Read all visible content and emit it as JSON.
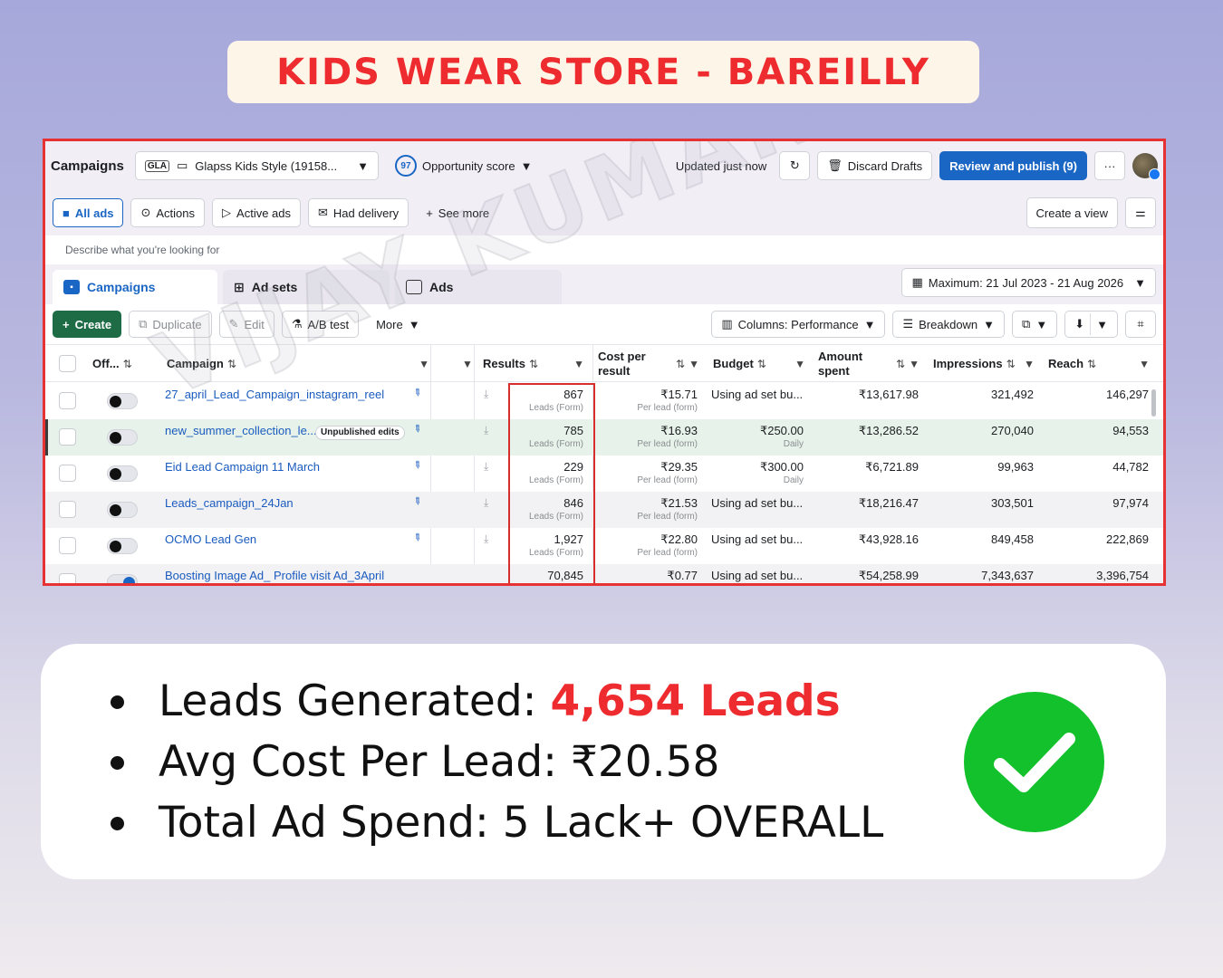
{
  "banner": {
    "title": "KIDS WEAR STORE - BAREILLY"
  },
  "topbar": {
    "title": "Campaigns",
    "account_badge": "GLA",
    "account": "Glapss Kids Style (19158...",
    "score_value": "97",
    "score_label": "Opportunity score",
    "updated": "Updated just now",
    "discard": "Discard Drafts",
    "review": "Review and publish (9)",
    "more": "···"
  },
  "filters": {
    "all_ads": "All ads",
    "actions": "Actions",
    "active_ads": "Active ads",
    "had_delivery": "Had delivery",
    "see_more": "See more",
    "create_view": "Create a view"
  },
  "search": {
    "placeholder": "Describe what you're looking for"
  },
  "tabs": {
    "campaigns": "Campaigns",
    "adsets": "Ad sets",
    "ads": "Ads",
    "date_range": "Maximum: 21 Jul 2023 - 21 Aug 2026"
  },
  "toolbar": {
    "create": "Create",
    "duplicate": "Duplicate",
    "edit": "Edit",
    "abtest": "A/B test",
    "more": "More",
    "columns": "Columns: Performance",
    "breakdown": "Breakdown"
  },
  "columns": {
    "off": "Off...",
    "campaign": "Campaign",
    "results": "Results",
    "cost_per_result": "Cost per result",
    "budget": "Budget",
    "amount_spent": "Amount spent",
    "impressions": "Impressions",
    "reach": "Reach"
  },
  "rows": [
    {
      "name": "27_april_Lead_Campaign_instagram_reel",
      "results": "867",
      "results_sub": "Leads (Form)",
      "cpr": "₹15.71",
      "cpr_sub": "Per lead (form)",
      "budget": "Using ad set bu...",
      "budget_sub": "",
      "spent": "₹13,617.98",
      "impressions": "321,492",
      "reach": "146,297",
      "badge": ""
    },
    {
      "name": "new_summer_collection_le...",
      "results": "785",
      "results_sub": "Leads (Form)",
      "cpr": "₹16.93",
      "cpr_sub": "Per lead (form)",
      "budget": "₹250.00",
      "budget_sub": "Daily",
      "spent": "₹13,286.52",
      "impressions": "270,040",
      "reach": "94,553",
      "badge": "Unpublished edits"
    },
    {
      "name": "Eid Lead Campaign 11 March",
      "results": "229",
      "results_sub": "Leads (Form)",
      "cpr": "₹29.35",
      "cpr_sub": "Per lead (form)",
      "budget": "₹300.00",
      "budget_sub": "Daily",
      "spent": "₹6,721.89",
      "impressions": "99,963",
      "reach": "44,782",
      "badge": ""
    },
    {
      "name": "Leads_campaign_24Jan",
      "results": "846",
      "results_sub": "Leads (Form)",
      "cpr": "₹21.53",
      "cpr_sub": "Per lead (form)",
      "budget": "Using ad set bu...",
      "budget_sub": "",
      "spent": "₹18,216.47",
      "impressions": "303,501",
      "reach": "97,974",
      "badge": ""
    },
    {
      "name": "OCMO Lead Gen",
      "results": "1,927",
      "results_sub": "Leads (Form)",
      "cpr": "₹22.80",
      "cpr_sub": "Per lead (form)",
      "budget": "Using ad set bu...",
      "budget_sub": "",
      "spent": "₹43,928.16",
      "impressions": "849,458",
      "reach": "222,869",
      "badge": ""
    },
    {
      "name": "Boosting Image Ad_ Profile visit Ad_3April",
      "results": "70,845",
      "results_sub": "",
      "cpr": "₹0.77",
      "cpr_sub": "",
      "budget": "Using ad set bu...",
      "budget_sub": "",
      "spent": "₹54,258.99",
      "impressions": "7,343,637",
      "reach": "3,396,754",
      "badge": ""
    }
  ],
  "watermark": "VIJAY KUMAR",
  "summary": {
    "leads_label": "Leads Generated: ",
    "leads_value": "4,654 Leads",
    "cpl": "Avg Cost Per Lead: ₹20.58",
    "spend": "Total Ad Spend: 5 Lack+ OVERALL"
  },
  "colors": {
    "accent": "#1a66c4",
    "highlight_red": "#ee2b2f",
    "check_green": "#12c12b"
  }
}
